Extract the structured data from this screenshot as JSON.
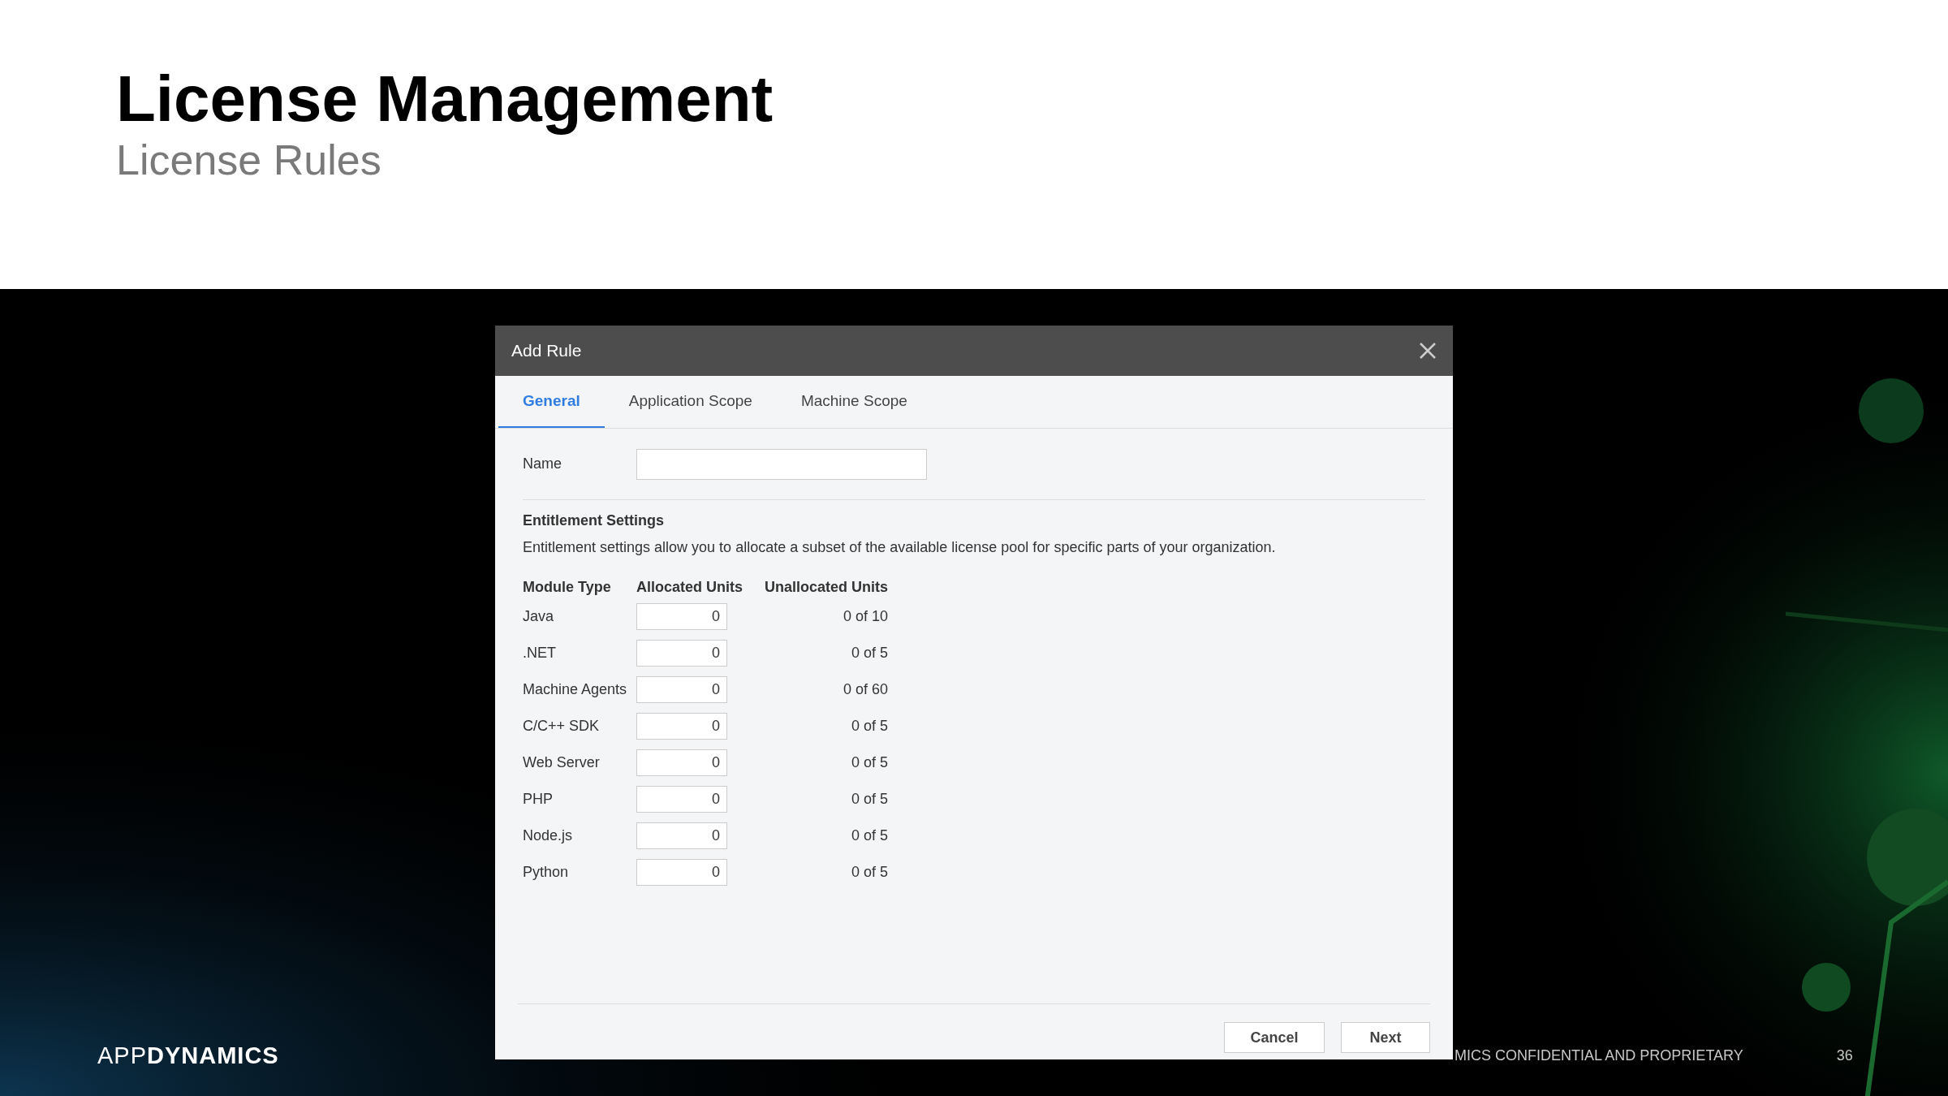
{
  "slide": {
    "title": "License Management",
    "subtitle": "License Rules"
  },
  "dialog": {
    "title": "Add Rule",
    "tabs": [
      {
        "label": "General",
        "selected": true
      },
      {
        "label": "Application Scope",
        "selected": false
      },
      {
        "label": "Machine Scope",
        "selected": false
      }
    ],
    "name_field": {
      "label": "Name"
    },
    "section": {
      "heading": "Entitlement Settings",
      "description": "Entitlement settings allow you to allocate a subset of the available license pool for specific parts of your organization."
    },
    "table": {
      "columns": [
        "Module Type",
        "Allocated Units",
        "Unallocated Units"
      ],
      "rows": [
        {
          "module": "Java",
          "allocated": "0",
          "unallocated": "0 of 10"
        },
        {
          "module": ".NET",
          "allocated": "0",
          "unallocated": "0 of 5"
        },
        {
          "module": "Machine Agents",
          "allocated": "0",
          "unallocated": "0 of 60"
        },
        {
          "module": "C/C++ SDK",
          "allocated": "0",
          "unallocated": "0 of 5"
        },
        {
          "module": "Web Server",
          "allocated": "0",
          "unallocated": "0 of 5"
        },
        {
          "module": "PHP",
          "allocated": "0",
          "unallocated": "0 of 5"
        },
        {
          "module": "Node.js",
          "allocated": "0",
          "unallocated": "0 of 5"
        },
        {
          "module": "Python",
          "allocated": "0",
          "unallocated": "0 of 5"
        }
      ]
    },
    "buttons": [
      "Cancel",
      "Next"
    ]
  },
  "footer": {
    "logo": [
      "APP",
      "DYNAMICS"
    ],
    "notice": "MICS CONFIDENTIAL AND PROPRIETARY",
    "page": "36"
  }
}
